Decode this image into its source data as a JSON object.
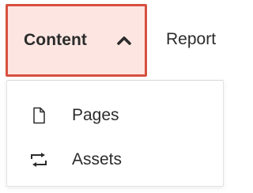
{
  "navbar": {
    "items": [
      {
        "label": "Content",
        "state": "open",
        "icon": "chevron-up-icon"
      },
      {
        "label": "Report"
      }
    ]
  },
  "dropdown": {
    "items": [
      {
        "label": "Pages",
        "icon": "page-icon"
      },
      {
        "label": "Assets",
        "icon": "assets-swap-icon"
      }
    ]
  },
  "colors": {
    "active_bg": "#fde6e2",
    "active_border": "#d7503f",
    "text": "#2b2b2b"
  }
}
